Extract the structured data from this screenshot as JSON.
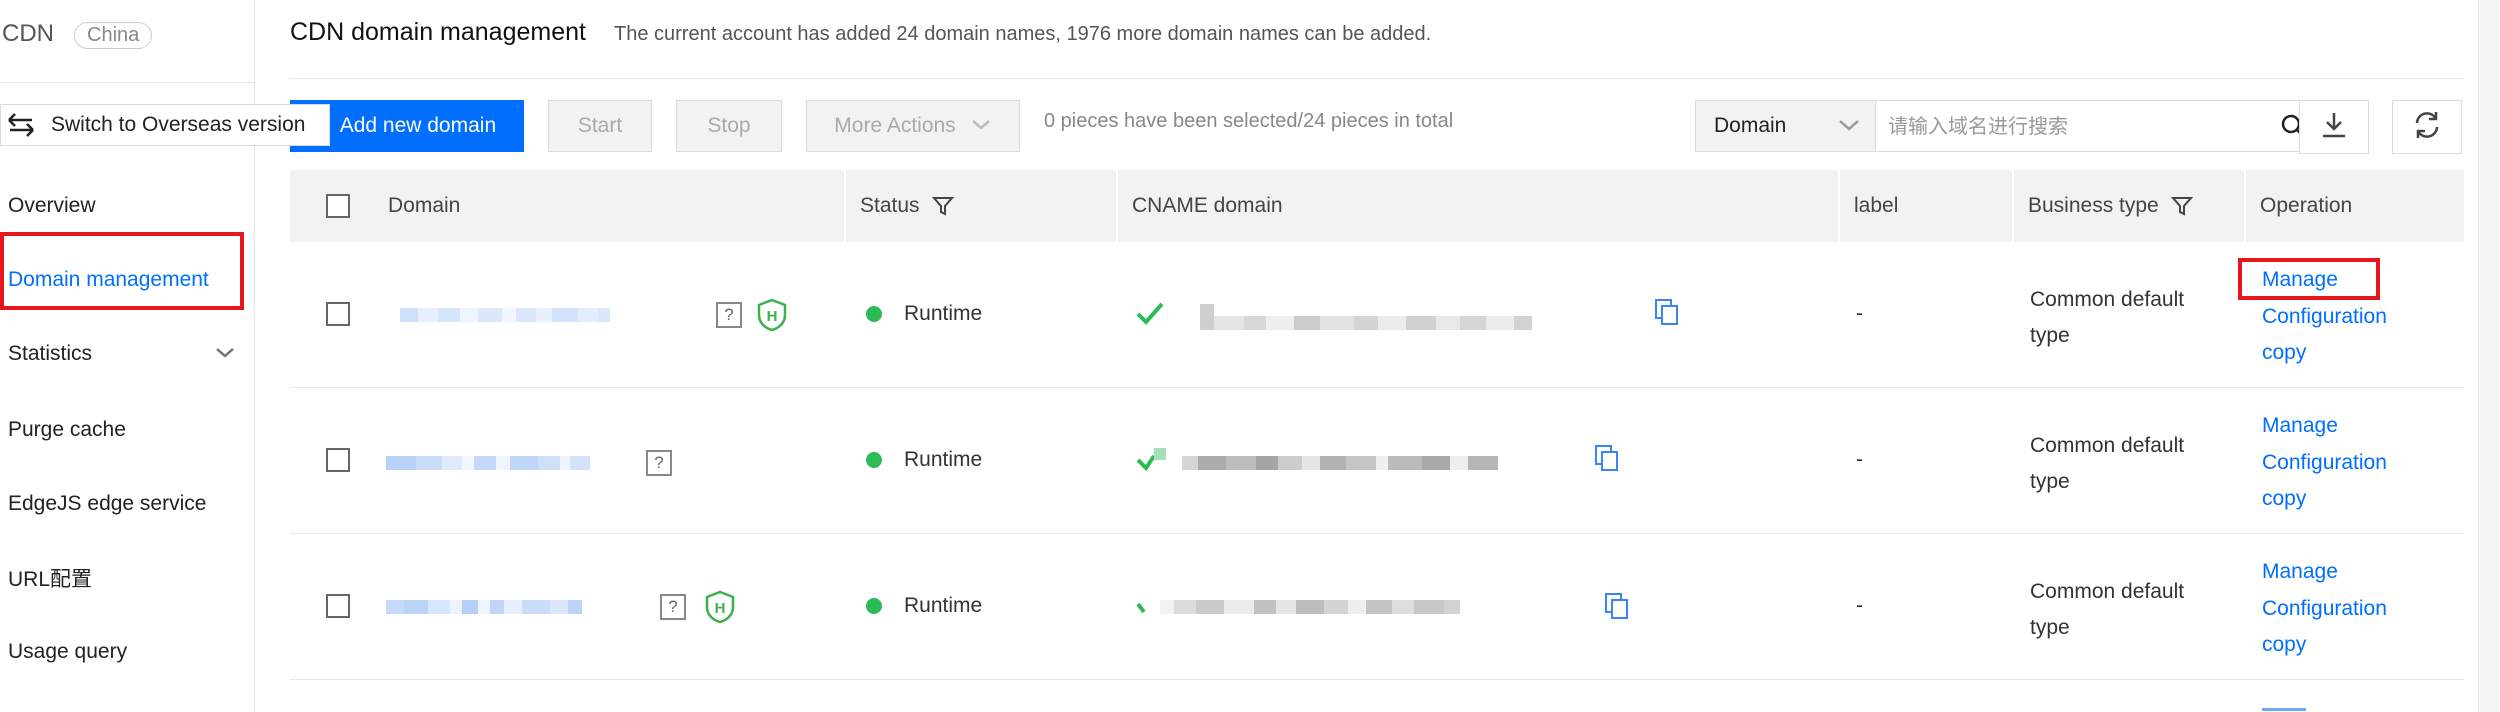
{
  "sidebar": {
    "brand": "CDN",
    "region_badge": "China",
    "switch_label": "Switch to Overseas version",
    "items": [
      {
        "label": "Overview"
      },
      {
        "label": "Domain management"
      },
      {
        "label": "Statistics"
      },
      {
        "label": "Purge cache"
      },
      {
        "label": "EdgeJS edge service"
      },
      {
        "label": "URL配置"
      },
      {
        "label": "Usage query"
      }
    ]
  },
  "header": {
    "title": "CDN domain management",
    "subtitle": "The current account has added 24 domain names, 1976 more domain names can be added."
  },
  "toolbar": {
    "add_label": "Add new domain",
    "start_label": "Start",
    "stop_label": "Stop",
    "more_label": "More Actions",
    "selection_info": "0 pieces have been selected/24 pieces in total",
    "search_type": "Domain",
    "search_placeholder": "请输入域名进行搜索"
  },
  "table": {
    "columns": {
      "domain": "Domain",
      "status": "Status",
      "cname": "CNAME domain",
      "label": "label",
      "business_type": "Business type",
      "operation": "Operation"
    },
    "rows": [
      {
        "status": "Runtime",
        "label": "-",
        "business_type_line1": "Common default",
        "business_type_line2": "type",
        "op_manage": "Manage",
        "op_config": "Configuration",
        "op_copy": "copy"
      },
      {
        "status": "Runtime",
        "label": "-",
        "business_type_line1": "Common default",
        "business_type_line2": "type",
        "op_manage": "Manage",
        "op_config": "Configuration",
        "op_copy": "copy"
      },
      {
        "status": "Runtime",
        "label": "-",
        "business_type_line1": "Common default",
        "business_type_line2": "type",
        "op_manage": "Manage",
        "op_config": "Configuration",
        "op_copy": "copy"
      }
    ]
  },
  "colors": {
    "primary": "#006eff",
    "status_running": "#2dbb55",
    "highlight_red": "#e8151d"
  },
  "icons": [
    "switch-arrows-icon",
    "chevron-down-icon",
    "plus-icon",
    "search-icon",
    "download-icon",
    "refresh-icon",
    "filter-icon",
    "help-icon",
    "shield-icon",
    "copy-icon",
    "check-icon"
  ]
}
